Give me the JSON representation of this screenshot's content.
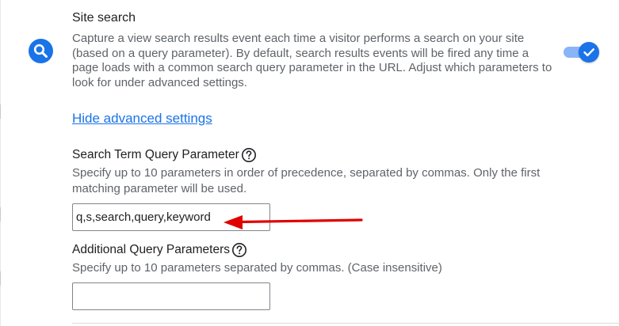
{
  "site_search": {
    "title": "Site search",
    "description": "Capture a view search results event each time a visitor performs a search on your site (based on a query parameter). By default, search results events will be fired any time a page loads with a common search query parameter in the URL. Adjust which parameters to look for under advanced settings.",
    "icon": "search-icon",
    "enabled": true,
    "accent_color": "#1a73e8"
  },
  "advanced_link": "Hide advanced settings",
  "search_term_param": {
    "label": "Search Term Query Parameter",
    "help_icon": "help-circle-icon",
    "description": "Specify up to 10 parameters in order of precedence, separated by commas. Only the first matching parameter will be used.",
    "value": "q,s,search,query,keyword"
  },
  "additional_params": {
    "label": "Additional Query Parameters",
    "help_icon": "help-circle-icon",
    "description": "Specify up to 10 parameters separated by commas. (Case insensitive)",
    "value": ""
  },
  "annotation": {
    "type": "red-arrow",
    "color": "#e00000"
  }
}
